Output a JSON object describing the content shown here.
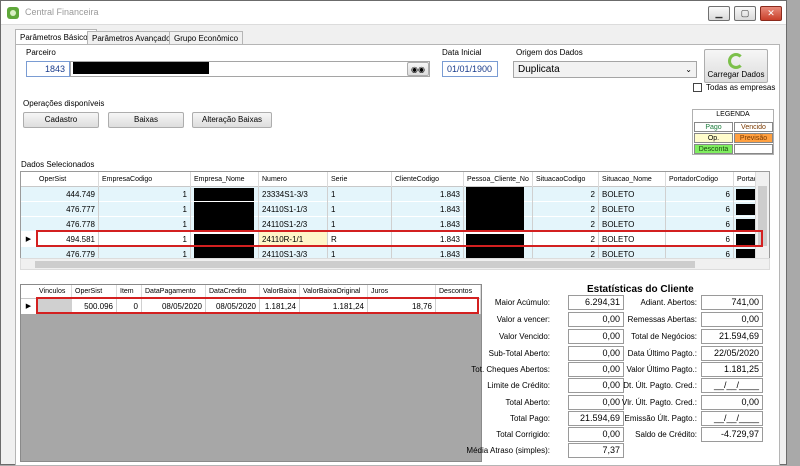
{
  "window": {
    "title": "Central Financeira",
    "buttons": {
      "minimize": "▁",
      "maximize": "▢",
      "close": "✕"
    }
  },
  "tabs": [
    "Parâmetros Básicos",
    "Parâmetros Avançados",
    "Grupo Econômico"
  ],
  "filters": {
    "parceiro_label": "Parceiro",
    "parceiro_code": "1843",
    "data_inicial_label": "Data Inicial",
    "data_inicial": "01/01/1900",
    "origem_label": "Origem dos Dados",
    "origem_value": "Duplicata",
    "carregar_label": "Carregar Dados",
    "todas_empresas_label": "Todas as empresas"
  },
  "operacoes": {
    "label": "Operações disponíveis",
    "buttons": [
      "Cadastro",
      "Baixas",
      "Alteração Baixas"
    ]
  },
  "legend": {
    "title": "LEGENDA",
    "items": [
      {
        "label": "Pago",
        "color": "#ffffff",
        "text_color": "#1a7a3a"
      },
      {
        "label": "Vencido",
        "color": "#ffffff",
        "text_color": "#7a3a00"
      },
      {
        "label": "Op.",
        "color": "#fffccc",
        "text_color": "#000000"
      },
      {
        "label": "Previsão",
        "color": "#ffa040",
        "text_color": "#7a3a00"
      },
      {
        "label": "Desconta",
        "color": "#80ee60",
        "text_color": "#1a4a10"
      },
      {
        "label": "",
        "color": "#ffffff",
        "text_color": "#000000"
      }
    ]
  },
  "dados": {
    "label": "Dados Selecionados",
    "columns": [
      "OperSist",
      "EmpresaCodigo",
      "Empresa_Nome",
      "Numero",
      "Serie",
      "ClienteCodigo",
      "Pessoa_Cliente_No",
      "SituacaoCodigo",
      "Situacao_Nome",
      "PortadorCodigo",
      "Portador_No"
    ],
    "rows": [
      {
        "oper": "444.749",
        "emp": "1",
        "numero": "23334S1-3/3",
        "serie": "1",
        "cli": "1.843",
        "sit": "2",
        "sitnome": "BOLETO",
        "port": "6"
      },
      {
        "oper": "476.777",
        "emp": "1",
        "numero": "24110S1-1/3",
        "serie": "1",
        "cli": "1.843",
        "sit": "2",
        "sitnome": "BOLETO",
        "port": "6"
      },
      {
        "oper": "476.778",
        "emp": "1",
        "numero": "24110S1-2/3",
        "serie": "1",
        "cli": "1.843",
        "sit": "2",
        "sitnome": "BOLETO",
        "port": "6"
      },
      {
        "oper": "494.581",
        "emp": "1",
        "numero": "24110R-1/1",
        "serie": "R",
        "cli": "1.843",
        "sit": "2",
        "sitnome": "BOLETO",
        "port": "6"
      },
      {
        "oper": "476.779",
        "emp": "1",
        "numero": "24110S1-3/3",
        "serie": "1",
        "cli": "1.843",
        "sit": "2",
        "sitnome": "BOLETO",
        "port": "6"
      }
    ]
  },
  "baixas": {
    "columns": [
      "Vinculos",
      "OperSist",
      "Item",
      "DataPagamento",
      "DataCredito",
      "ValorBaixa",
      "ValorBaixaOriginal",
      "Juros",
      "Descontos"
    ],
    "row": {
      "vinculos": "",
      "oper": "500.096",
      "item": "0",
      "datapag": "08/05/2020",
      "datacred": "08/05/2020",
      "valor": "1.181,24",
      "valororig": "1.181,24",
      "juros": "18,76",
      "descontos": ""
    }
  },
  "stats": {
    "title": "Estatísticas do Cliente",
    "left": [
      {
        "label": "Maior Acúmulo:",
        "value": "6.294,31"
      },
      {
        "label": "Valor a vencer:",
        "value": "0,00"
      },
      {
        "label": "Valor Vencido:",
        "value": "0,00"
      },
      {
        "label": "Sub-Total Aberto:",
        "value": "0,00"
      },
      {
        "label": "Tot. Cheques Abertos:",
        "value": "0,00"
      },
      {
        "label": "Limite de Crédito:",
        "value": "0,00"
      },
      {
        "label": "Total Aberto:",
        "value": "0,00"
      },
      {
        "label": "Total Pago:",
        "value": "21.594,69"
      },
      {
        "label": "Total Corrigido:",
        "value": "0,00"
      },
      {
        "label": "Média Atraso (simples):",
        "value": "7,37"
      }
    ],
    "right": [
      {
        "label": "Adiant. Abertos:",
        "value": "741,00"
      },
      {
        "label": "Remessas Abertas:",
        "value": "0,00"
      },
      {
        "label": "Total de Negócios:",
        "value": "21.594,69"
      },
      {
        "label": "Data Último Pagto.:",
        "value": "22/05/2020"
      },
      {
        "label": "Valor Último Pagto.:",
        "value": "1.181,25"
      },
      {
        "label": "Dt. Últ. Pagto. Cred.:",
        "value": "__/__/____"
      },
      {
        "label": "Vlr. Últ. Pagto. Cred.:",
        "value": "0,00"
      },
      {
        "label": "Emissão Últ. Pagto.:",
        "value": "__/__/____"
      },
      {
        "label": "Saldo de Crédito:",
        "value": "-4.729,97"
      }
    ]
  }
}
